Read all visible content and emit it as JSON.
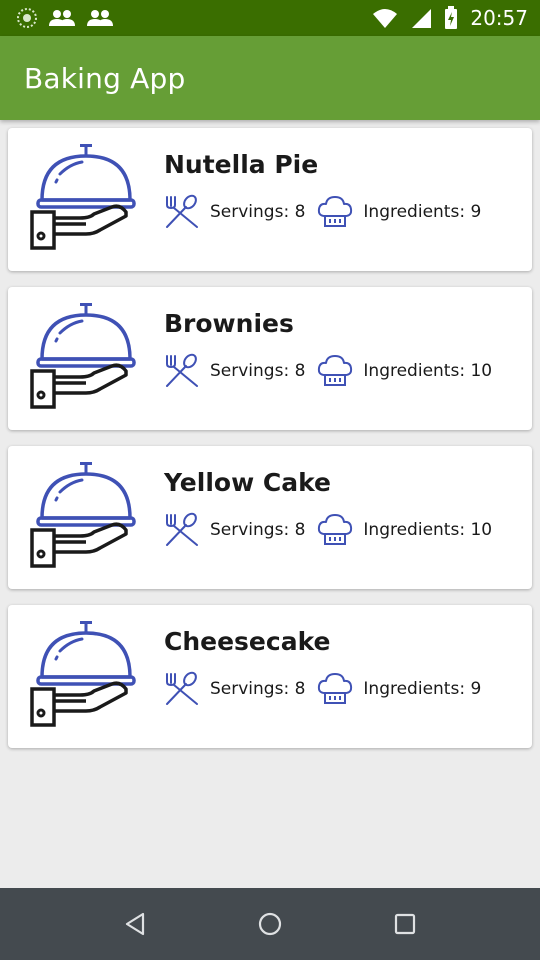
{
  "status_bar": {
    "time": "20:57",
    "icons": [
      "sync-icon",
      "people-icon",
      "people-icon",
      "wifi-icon",
      "cell-signal-icon",
      "battery-charging-icon"
    ]
  },
  "app_bar": {
    "title": "Baking App",
    "color": "#669e36",
    "status_color": "#3a6e00"
  },
  "recipes": [
    {
      "name": "Nutella Pie",
      "servings": "Servings: 8",
      "ingredients": "Ingredients: 9"
    },
    {
      "name": "Brownies",
      "servings": "Servings: 8",
      "ingredients": "Ingredients: 10"
    },
    {
      "name": "Yellow Cake",
      "servings": "Servings: 8",
      "ingredients": "Ingredients: 10"
    },
    {
      "name": "Cheesecake",
      "servings": "Servings: 8",
      "ingredients": "Ingredients: 9"
    }
  ],
  "icons": {
    "thumbnail": "serving-cloche-icon",
    "servings": "fork-spoon-icon",
    "ingredients": "chef-hat-icon"
  },
  "nav": [
    "back-icon",
    "home-icon",
    "recents-icon"
  ],
  "colors": {
    "icon_blue": "#3f51b5"
  }
}
